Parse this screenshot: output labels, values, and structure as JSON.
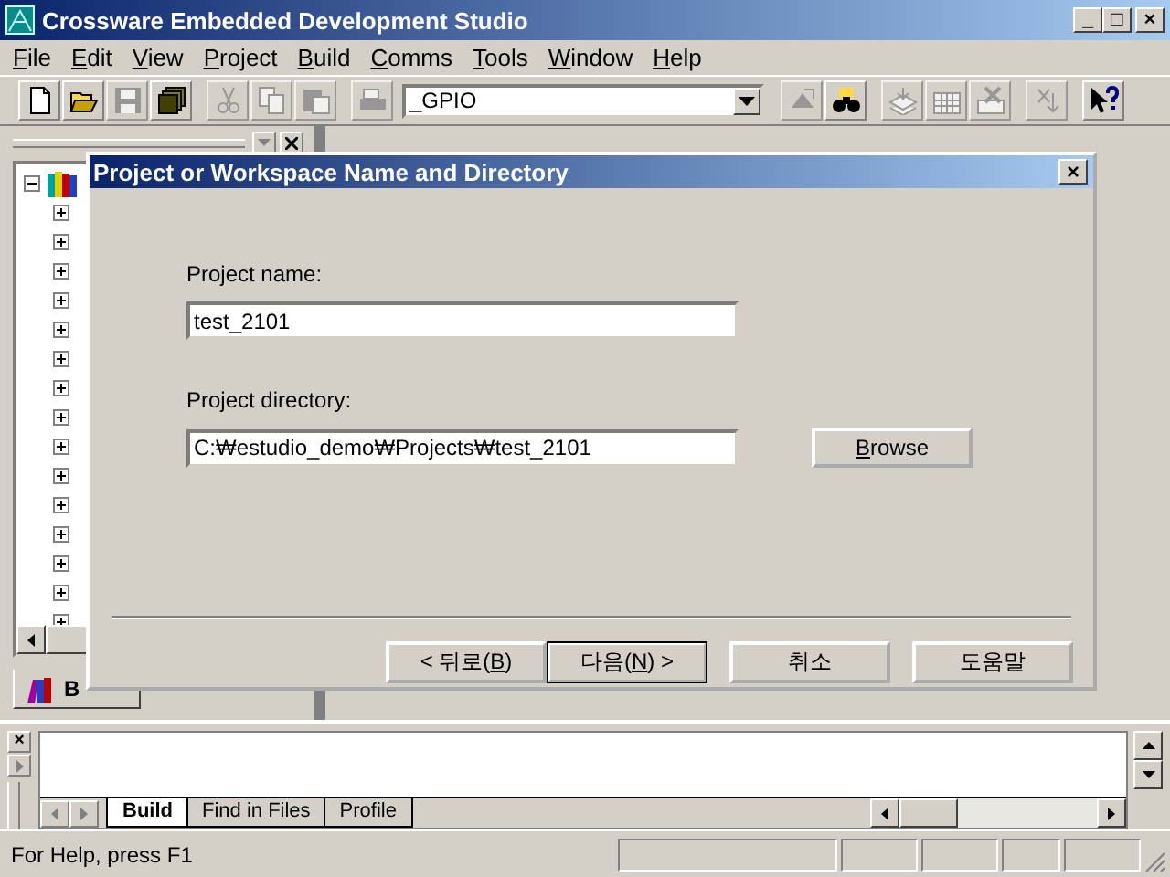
{
  "window": {
    "title": "Crossware Embedded Development Studio",
    "controls": [
      "_",
      "□",
      "×"
    ]
  },
  "menu": [
    {
      "label": "File"
    },
    {
      "label": "Edit"
    },
    {
      "label": "View"
    },
    {
      "label": "Project"
    },
    {
      "label": "Build"
    },
    {
      "label": "Comms"
    },
    {
      "label": "Tools"
    },
    {
      "label": "Window"
    },
    {
      "label": "Help"
    }
  ],
  "toolbar": {
    "left": [
      {
        "kind": "new",
        "disabled": false
      },
      {
        "kind": "open",
        "disabled": false
      },
      {
        "kind": "save",
        "disabled": true
      },
      {
        "kind": "saveall",
        "disabled": false
      },
      {
        "kind": "sep"
      },
      {
        "kind": "cut",
        "disabled": true
      },
      {
        "kind": "copy",
        "disabled": true
      },
      {
        "kind": "paste",
        "disabled": true
      },
      {
        "kind": "sep"
      },
      {
        "kind": "print",
        "disabled": true
      }
    ],
    "combo": {
      "value": "_GPIO"
    },
    "right": [
      {
        "kind": "compile",
        "disabled": true
      },
      {
        "kind": "find",
        "disabled": false
      },
      {
        "kind": "sep"
      },
      {
        "kind": "stack",
        "disabled": true
      },
      {
        "kind": "grid",
        "disabled": true
      },
      {
        "kind": "stop",
        "disabled": true
      },
      {
        "kind": "sep"
      },
      {
        "kind": "step",
        "disabled": true
      },
      {
        "kind": "sep"
      },
      {
        "kind": "whatsthis",
        "disabled": false
      }
    ]
  },
  "workspace": {
    "tree": {
      "expanded": true,
      "children": [
        {
          "expanded": false
        },
        {
          "expanded": false
        },
        {
          "expanded": false
        },
        {
          "expanded": false
        },
        {
          "expanded": false
        },
        {
          "expanded": false
        },
        {
          "expanded": false
        },
        {
          "expanded": false
        },
        {
          "expanded": false
        },
        {
          "expanded": false
        },
        {
          "expanded": false
        },
        {
          "expanded": false
        },
        {
          "expanded": false
        },
        {
          "expanded": false
        },
        {
          "expanded": false
        }
      ]
    },
    "tab": {
      "label": "B"
    }
  },
  "dialog": {
    "title": "Project or Workspace Name and Directory",
    "close": "×",
    "fields": [
      {
        "label": "Project name:",
        "value": "test_2101"
      },
      {
        "label": "Project directory:",
        "value": "C:₩estudio_demo₩Projects₩test_2101",
        "browse": {
          "label": "Browse"
        }
      }
    ],
    "buttons": [
      {
        "label": "< 뒤로(B)",
        "default": false
      },
      {
        "label": "다음(N) >",
        "default": true
      },
      {
        "label": "취소",
        "default": false
      },
      {
        "label": "도움말",
        "default": false
      }
    ]
  },
  "output": {
    "close": "×",
    "tabs": [
      {
        "label": "Build",
        "selected": true
      },
      {
        "label": "Find in Files",
        "selected": false
      },
      {
        "label": "Profile",
        "selected": false
      }
    ]
  },
  "status_bar": {
    "text": "For Help, press F1"
  }
}
